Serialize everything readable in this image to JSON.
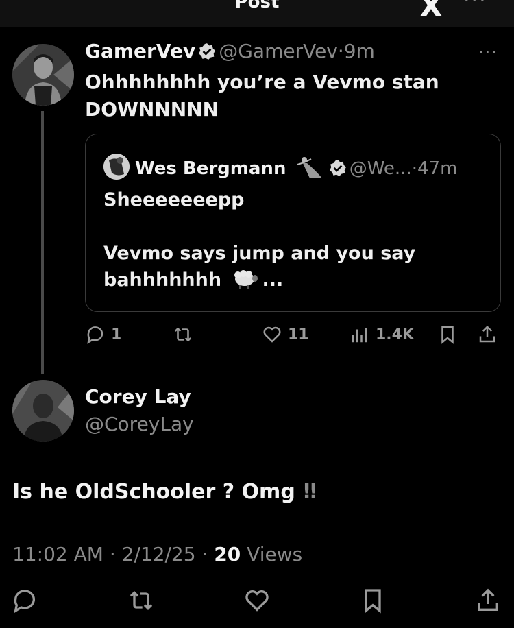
{
  "topbar": {
    "title": "Post",
    "logo": "X",
    "more": "···"
  },
  "reply": {
    "author": {
      "name": "GamerVev",
      "handle": "@GamerVev",
      "time": "9m"
    },
    "more": "···",
    "text": "Ohhhhhhhh you’re a Vevmo stan DOWNNNNN",
    "quote": {
      "author": {
        "name": "Wes Bergmann",
        "handle": "@We...",
        "time": "47m"
      },
      "line1": "Sheeeeeeepp",
      "line2": "Vevmo says jump and you say bahhhhhhh",
      "ellipsis": "..."
    },
    "actions": {
      "replies": "1",
      "likes": "11",
      "views": "1.4K"
    }
  },
  "main": {
    "author": {
      "name": "Corey Lay",
      "handle": "@CoreyLay"
    },
    "text": "Is he OldSchooler ? Omg",
    "emphasis": "!!",
    "meta": {
      "time": "11:02 AM",
      "date": "2/12/25",
      "views_count": "20",
      "views_label": "Views"
    }
  },
  "separator": "·",
  "colors": {
    "background": "#000000",
    "text": "#f3f3f3",
    "muted": "#8a8a8a",
    "border": "#3a3a3a"
  }
}
